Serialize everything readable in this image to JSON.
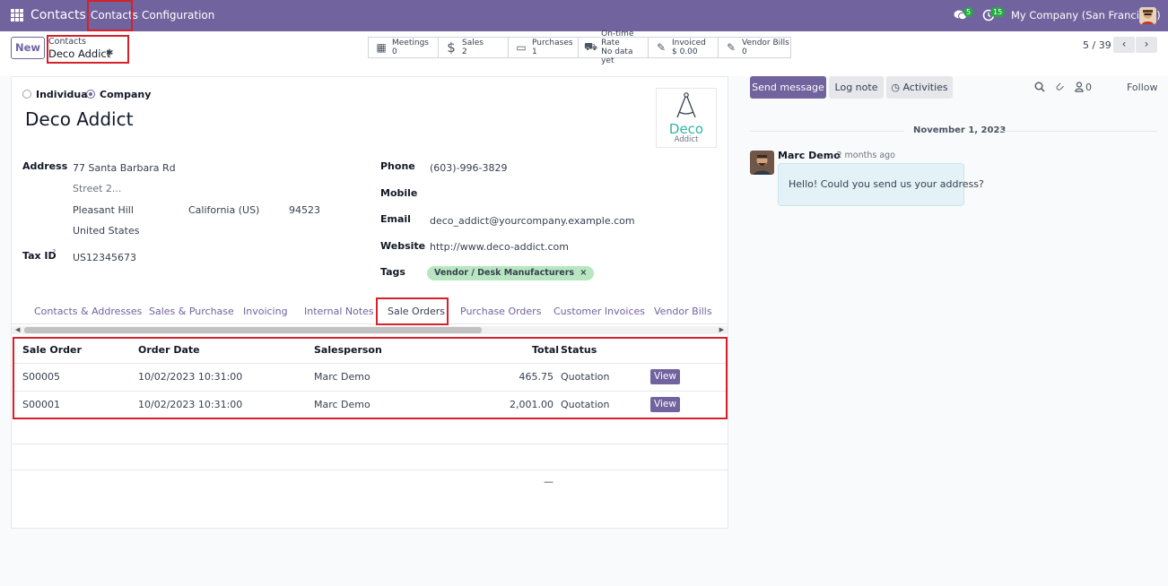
{
  "topbar": {
    "app_name": "Contacts",
    "menu": [
      "Contacts",
      "Configuration"
    ],
    "messages_count": "5",
    "activities_count": "15",
    "company": "My Company (San Francisco)"
  },
  "control_panel": {
    "new_label": "New",
    "breadcrumb_parent": "Contacts",
    "breadcrumb_current": "Deco Addict",
    "pager": "5 / 39",
    "smart_buttons": [
      {
        "label": "Meetings",
        "value": "0",
        "icon": "calendar-icon"
      },
      {
        "label": "Sales",
        "value": "2",
        "icon": "dollar-icon"
      },
      {
        "label": "Purchases",
        "value": "1",
        "icon": "credit-card-icon"
      },
      {
        "label": "On-time Rate",
        "value": "No data yet",
        "icon": "truck-icon"
      },
      {
        "label": "Invoiced",
        "value": "$ 0.00",
        "icon": "pencil-square-icon"
      },
      {
        "label": "Vendor Bills",
        "value": "0",
        "icon": "pencil-square-icon"
      }
    ]
  },
  "form": {
    "type_individual": "Individual",
    "type_company": "Company",
    "selected_type": "Company",
    "name": "Deco Addict",
    "address_label": "Address",
    "street": "77 Santa Barbara Rd",
    "street2_placeholder": "Street 2...",
    "city": "Pleasant Hill",
    "state": "California (US)",
    "zip": "94523",
    "country": "United States",
    "tax_id_label": "Tax ID",
    "tax_id_help": "?",
    "tax_id": "US12345673",
    "phone_label": "Phone",
    "phone": "(603)-996-3829",
    "mobile_label": "Mobile",
    "email_label": "Email",
    "email": "deco_addict@yourcompany.example.com",
    "website_label": "Website",
    "website": "http://www.deco-addict.com",
    "tags_label": "Tags",
    "tag": "Vendor / Desk Manufacturers",
    "logo_text": "Deco",
    "logo_subtext": "Addict"
  },
  "tabs": [
    "Contacts & Addresses",
    "Sales & Purchase",
    "Invoicing",
    "Internal Notes",
    "Sale Orders",
    "Purchase Orders",
    "Customer Invoices",
    "Vendor Bills"
  ],
  "active_tab": "Sale Orders",
  "table": {
    "headers": [
      "Sale Order",
      "Order Date",
      "Salesperson",
      "Total",
      "Status"
    ],
    "view_label": "View",
    "rows": [
      [
        "S00005",
        "10/02/2023 10:31:00",
        "Marc Demo",
        "465.75",
        "Quotation"
      ],
      [
        "S00001",
        "10/02/2023 10:31:00",
        "Marc Demo",
        "2,001.00",
        "Quotation"
      ]
    ],
    "footer_dash": "—"
  },
  "chatter": {
    "send_message": "Send message",
    "log_note": "Log note",
    "activities": "Activities",
    "followers_count": "0",
    "follow": "Follow",
    "date": "November 1, 2023",
    "author": "Marc Demo",
    "time": "- 2 months ago",
    "message": "Hello! Could you send us your address?"
  },
  "colors": {
    "brand": "#71639e",
    "highlight": "#d6212a",
    "tag": "#b8e6c0"
  }
}
